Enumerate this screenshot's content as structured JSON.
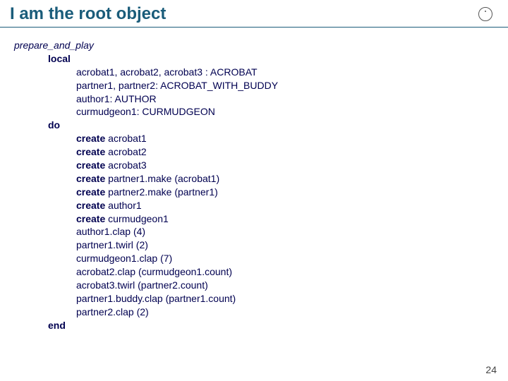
{
  "title": "I am the root object",
  "logo_name": "circle-dot-icon",
  "page_number": "24",
  "code": {
    "procedure": "prepare_and_play",
    "kw_local": "local",
    "decl": [
      "acrobat1, acrobat2, acrobat3 : ACROBAT",
      "partner1, partner2: ACROBAT_WITH_BUDDY",
      "author1: AUTHOR",
      "curmudgeon1: CURMUDGEON"
    ],
    "kw_do": "do",
    "kw_create": "create",
    "create_targets": [
      "acrobat1",
      "acrobat2",
      "acrobat3",
      "partner1.make (acrobat1)",
      "partner2.make (partner1)",
      "author1",
      "curmudgeon1"
    ],
    "calls": [
      "author1.clap (4)",
      "partner1.twirl (2)",
      "curmudgeon1.clap (7)",
      "acrobat2.clap (curmudgeon1.count)",
      "acrobat3.twirl (partner2.count)",
      "partner1.buddy.clap (partner1.count)",
      "partner2.clap (2)"
    ],
    "kw_end": "end"
  }
}
